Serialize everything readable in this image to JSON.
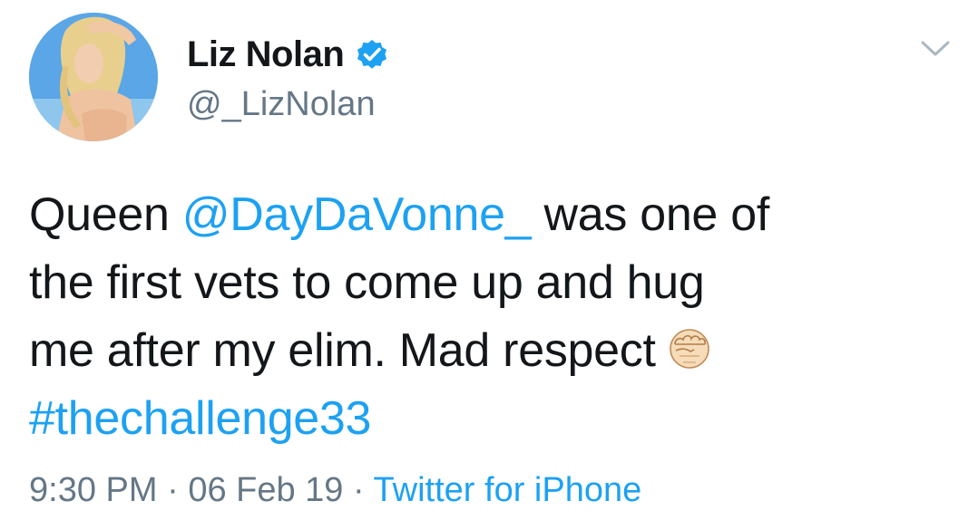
{
  "author": {
    "display_name": "Liz Nolan",
    "handle": "@_LizNolan",
    "verified": true,
    "avatar_icon": "profile-photo"
  },
  "tweet": {
    "line1_prefix": "Queen ",
    "mention": "@DayDaVonne_",
    "line1_suffix": " was one of",
    "line2": "the first vets to come up and hug",
    "line3": "me after my elim. Mad respect",
    "emoji": "raised-fist-emoji",
    "hashtag": "#thechallenge33"
  },
  "meta": {
    "time": "9:30 PM",
    "separator1": " · ",
    "date": "06 Feb 19",
    "separator2": " · ",
    "source": "Twitter for iPhone"
  },
  "icons": {
    "menu": "chevron-down-icon",
    "verified": "verified-badge-icon"
  },
  "colors": {
    "link": "#1da1f2",
    "text": "#14171a",
    "secondary": "#657786",
    "caret": "#aab8c2"
  }
}
